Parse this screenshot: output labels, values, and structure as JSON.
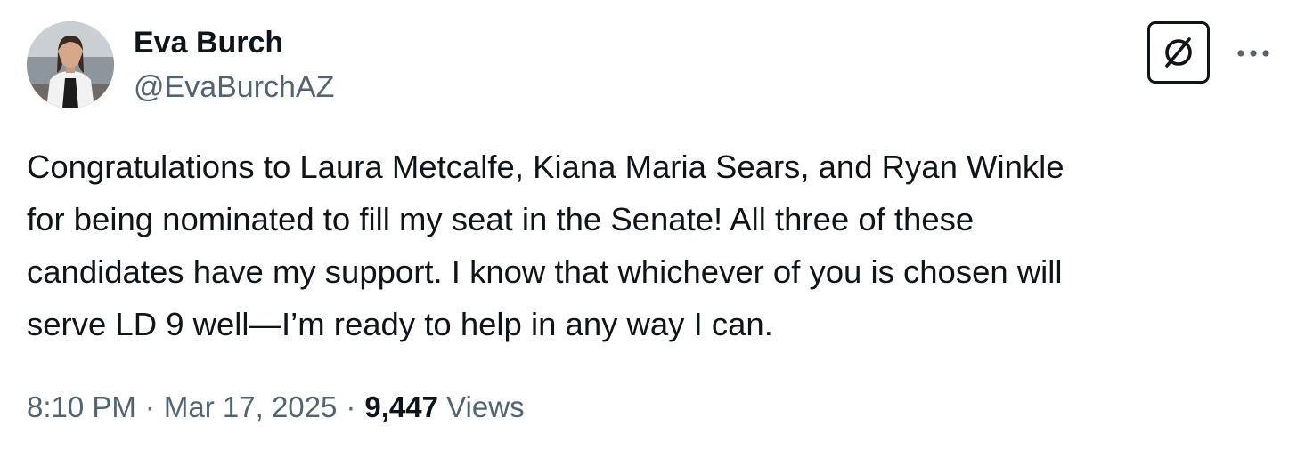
{
  "author": {
    "name": "Eva Burch",
    "handle": "@EvaBurchAZ"
  },
  "tweet": {
    "lines": [
      "Congratulations to Laura Metcalfe, Kiana Maria Sears, and Ryan Winkle",
      "for being nominated to fill my seat in the Senate! All three of these",
      "candidates have my support. I know that whichever of you is chosen will",
      "serve LD 9 well—I’m ready to help in any way I can."
    ]
  },
  "meta": {
    "time": "8:10 PM",
    "separator": "·",
    "date": "Mar 17, 2025",
    "views_count": "9,447",
    "views_label": "Views"
  },
  "icons": {
    "grok": "grok-icon",
    "more": "more-dots-icon"
  },
  "colors": {
    "text_primary": "#0f1419",
    "text_secondary": "#536471"
  }
}
